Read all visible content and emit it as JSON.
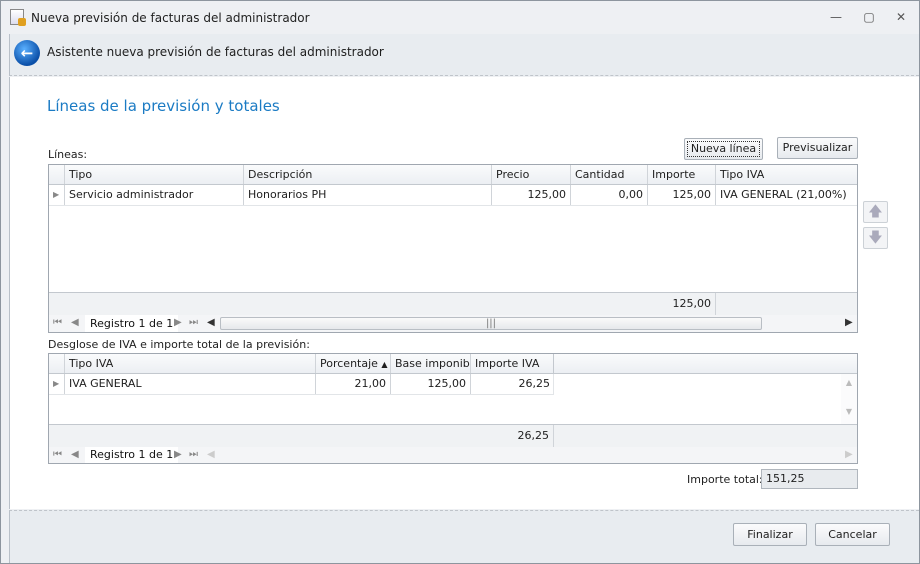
{
  "window": {
    "title": "Nueva previsión de facturas del administrador",
    "minimize": "—",
    "restore": "▢",
    "close": "✕"
  },
  "wizard": {
    "header": "Asistente nueva previsión de facturas del administrador",
    "section_title": "Líneas de la previsión y totales"
  },
  "lines": {
    "label": "Líneas:",
    "new_line": "Nueva línea",
    "preview": "Previsualizar",
    "columns": [
      "Tipo",
      "Descripción",
      "Precio",
      "Cantidad",
      "Importe",
      "Tipo IVA"
    ],
    "rows": [
      [
        "Servicio administrador",
        "Honorarios PH",
        "125,00",
        "0,00",
        "125,00",
        "IVA GENERAL (21,00%)"
      ]
    ],
    "total_importe": "125,00",
    "nav": "Registro 1 de 1"
  },
  "iva": {
    "label": "Desglose de IVA e importe total de la previsión:",
    "columns": [
      "Tipo IVA",
      "Porcentaje",
      "Base imponible",
      "Importe IVA"
    ],
    "rows": [
      [
        "IVA GENERAL",
        "21,00",
        "125,00",
        "26,25"
      ]
    ],
    "total_iva": "26,25",
    "nav": "Registro 1 de 1"
  },
  "total": {
    "label": "Importe total:",
    "value": "151,25"
  },
  "footer": {
    "finish": "Finalizar",
    "cancel": "Cancelar"
  }
}
